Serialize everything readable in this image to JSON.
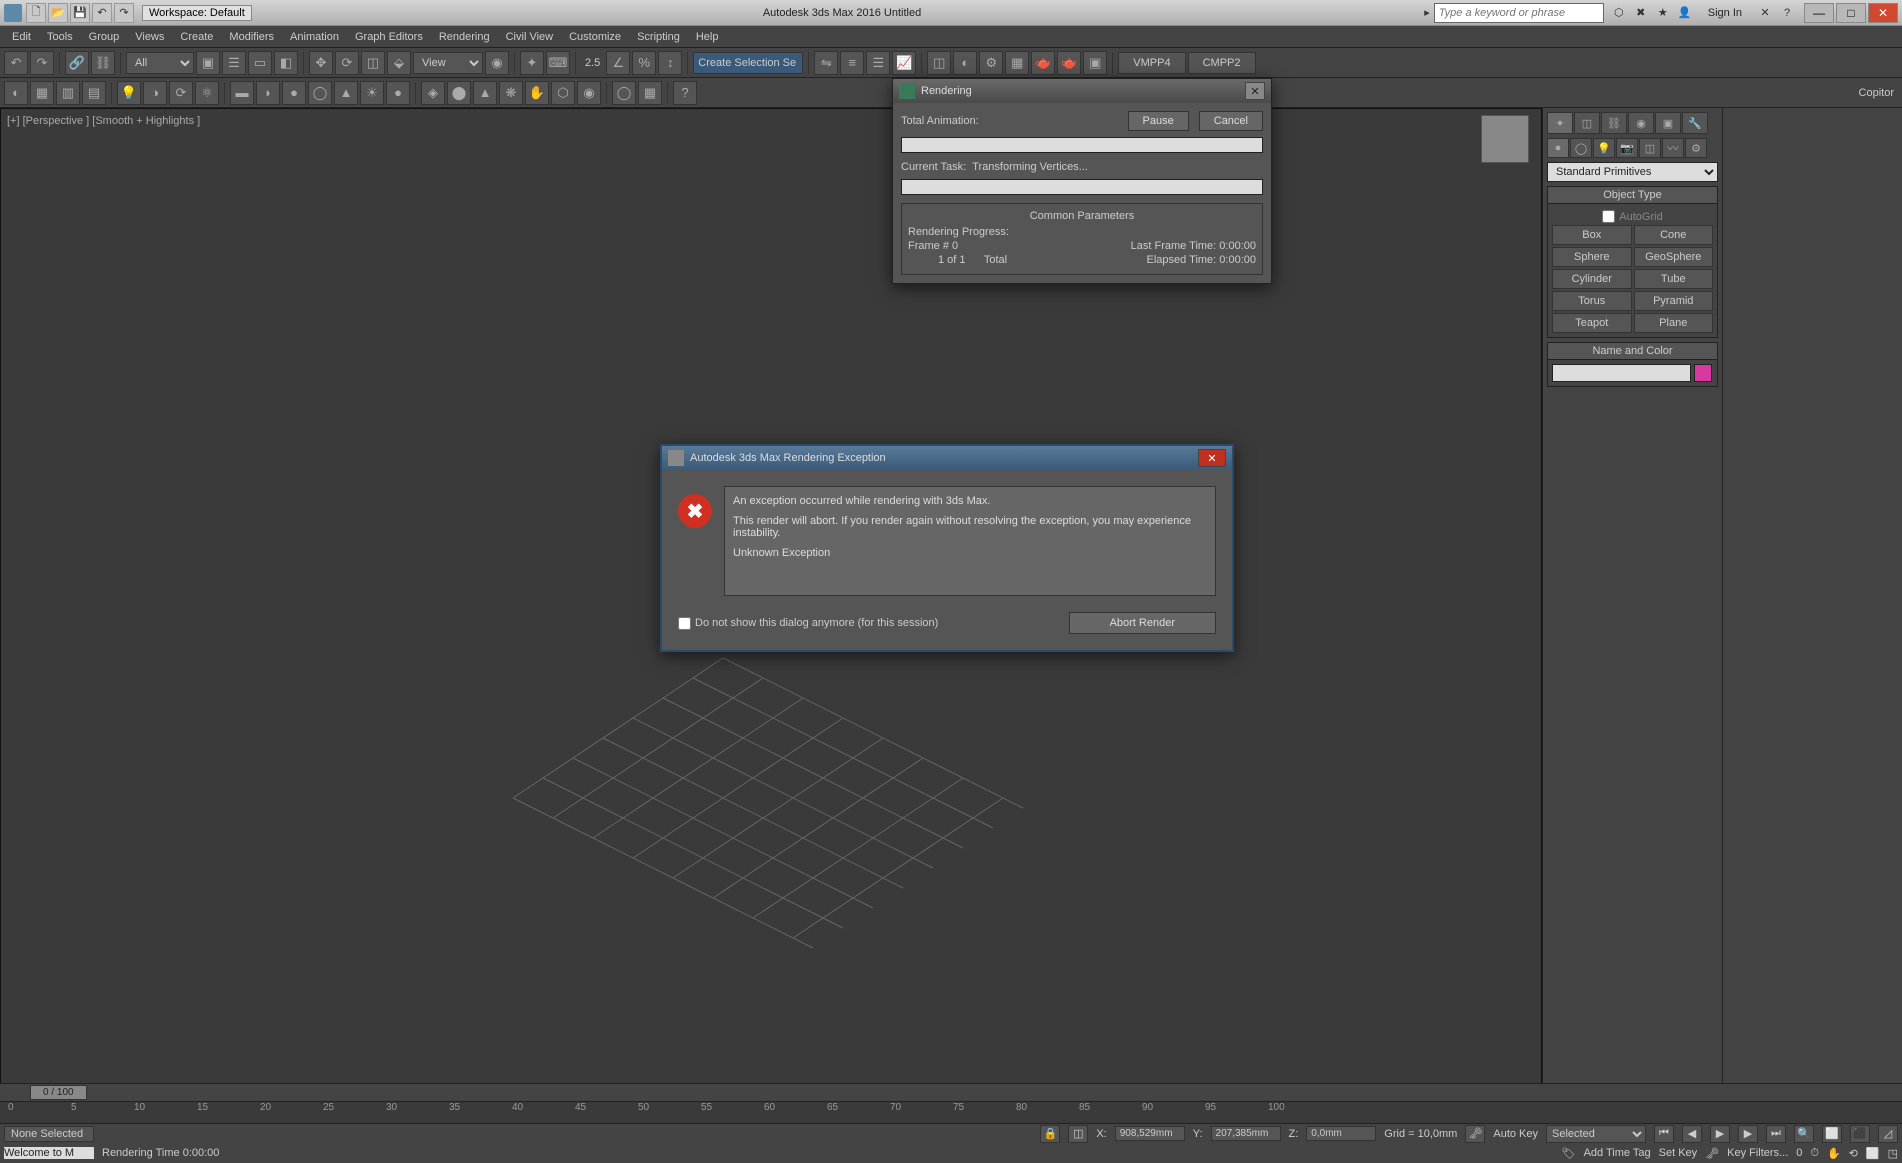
{
  "titlebar": {
    "workspace": "Workspace: Default",
    "title": "Autodesk 3ds Max 2016   Untitled",
    "search_placeholder": "Type a keyword or phrase",
    "signin": "Sign In"
  },
  "menubar": [
    "Edit",
    "Tools",
    "Group",
    "Views",
    "Create",
    "Modifiers",
    "Animation",
    "Graph Editors",
    "Rendering",
    "Civil View",
    "Customize",
    "Scripting",
    "Help"
  ],
  "toolbar1": {
    "filter_select": "All",
    "view_select": "View",
    "selset_placeholder": "Create Selection Se",
    "snap_label": "2.5",
    "btn1": "VMPP4",
    "btn2": "CMPP2"
  },
  "toolbar2_right": "Copitor",
  "viewport": {
    "label": "[+] [Perspective ] [Smooth + Highlights ]"
  },
  "command": {
    "category": "Standard Primitives",
    "rollout1": "Object Type",
    "autogrid": "AutoGrid",
    "objects": [
      "Box",
      "Cone",
      "Sphere",
      "GeoSphere",
      "Cylinder",
      "Tube",
      "Torus",
      "Pyramid",
      "Teapot",
      "Plane"
    ],
    "rollout2": "Name and Color"
  },
  "render_dlg": {
    "title": "Rendering",
    "total_anim": "Total Animation:",
    "pause": "Pause",
    "cancel": "Cancel",
    "current_task_label": "Current Task:",
    "current_task": "Transforming Vertices...",
    "params_head": "Common Parameters",
    "progress_label": "Rendering Progress:",
    "frame_label": "Frame #",
    "frame_val": "0",
    "of_label": "1 of  1",
    "total_label": "Total",
    "last_frame_label": "Last Frame Time:",
    "last_frame_val": "0:00:00",
    "elapsed_label": "Elapsed Time:",
    "elapsed_val": "0:00:00"
  },
  "except_dlg": {
    "title": "Autodesk 3ds Max Rendering Exception",
    "line1": "An exception occurred while rendering with 3ds Max.",
    "line2": "This render will abort. If you render again without resolving the exception, you may experience instability.",
    "line3": "Unknown Exception",
    "chk": "Do not show this dialog anymore (for this session)",
    "abort": "Abort Render"
  },
  "timeslider": {
    "pos": "0 / 100"
  },
  "trackbar_ticks": [
    "0",
    "5",
    "10",
    "15",
    "20",
    "25",
    "30",
    "35",
    "40",
    "45",
    "50",
    "55",
    "60",
    "65",
    "70",
    "75",
    "80",
    "85",
    "90",
    "95",
    "100"
  ],
  "status": {
    "welcome": "Welcome to M",
    "none_sel": "None Selected",
    "x": "908,529mm",
    "y": "207,385mm",
    "z": "0,0mm",
    "grid": "Grid = 10,0mm",
    "autokey": "Auto Key",
    "selected": "Selected",
    "render_time": "Rendering Time 0:00:00",
    "add_tag": "Add Time Tag",
    "setkey": "Set Key",
    "keyfilters": "Key Filters...",
    "zero": "0"
  }
}
